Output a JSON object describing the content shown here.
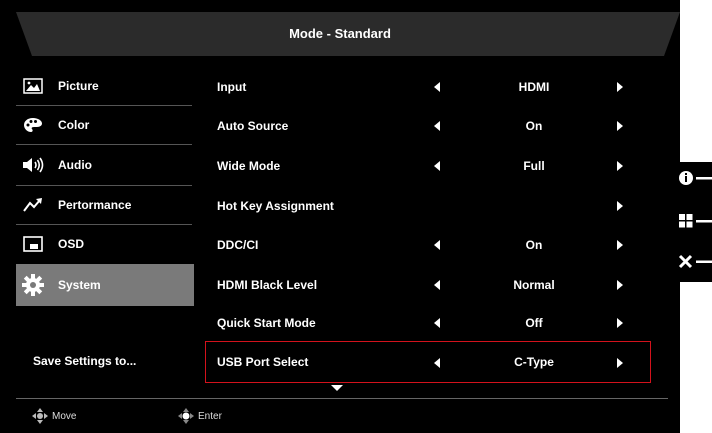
{
  "title": "Mode - Standard",
  "sidebar": {
    "items": [
      {
        "label": "Picture",
        "icon": "picture-icon",
        "active": false
      },
      {
        "label": "Color",
        "icon": "color-palette-icon",
        "active": false
      },
      {
        "label": "Audio",
        "icon": "speaker-icon",
        "active": false
      },
      {
        "label": "Pertormance",
        "icon": "performance-icon",
        "active": false
      },
      {
        "label": "OSD",
        "icon": "osd-icon",
        "active": false
      },
      {
        "label": "System",
        "icon": "gear-icon",
        "active": true
      }
    ],
    "save_settings": "Save Settings to..."
  },
  "settings": [
    {
      "name": "Input",
      "value": "HDMI",
      "arrows": "both"
    },
    {
      "name": "Auto Source",
      "value": "On",
      "arrows": "both"
    },
    {
      "name": "Wide Mode",
      "value": "Full",
      "arrows": "both"
    },
    {
      "name": "Hot Key Assignment",
      "value": "",
      "arrows": "right"
    },
    {
      "name": "DDC/CI",
      "value": "On",
      "arrows": "both"
    },
    {
      "name": "HDMI Black Level",
      "value": "Normal",
      "arrows": "both"
    },
    {
      "name": "Quick Start Mode",
      "value": "Off",
      "arrows": "both"
    },
    {
      "name": "USB Port Select",
      "value": "C-Type",
      "arrows": "both",
      "selected": true
    }
  ],
  "footer": {
    "move_label": "Move",
    "enter_label": "Enter"
  },
  "hotkeys": [
    "info-icon",
    "input-select-icon",
    "exit-icon"
  ],
  "colors": {
    "background": "#000000",
    "active_item": "#7a7a7a",
    "selection_border": "#d3121c",
    "text": "#ffffff"
  }
}
